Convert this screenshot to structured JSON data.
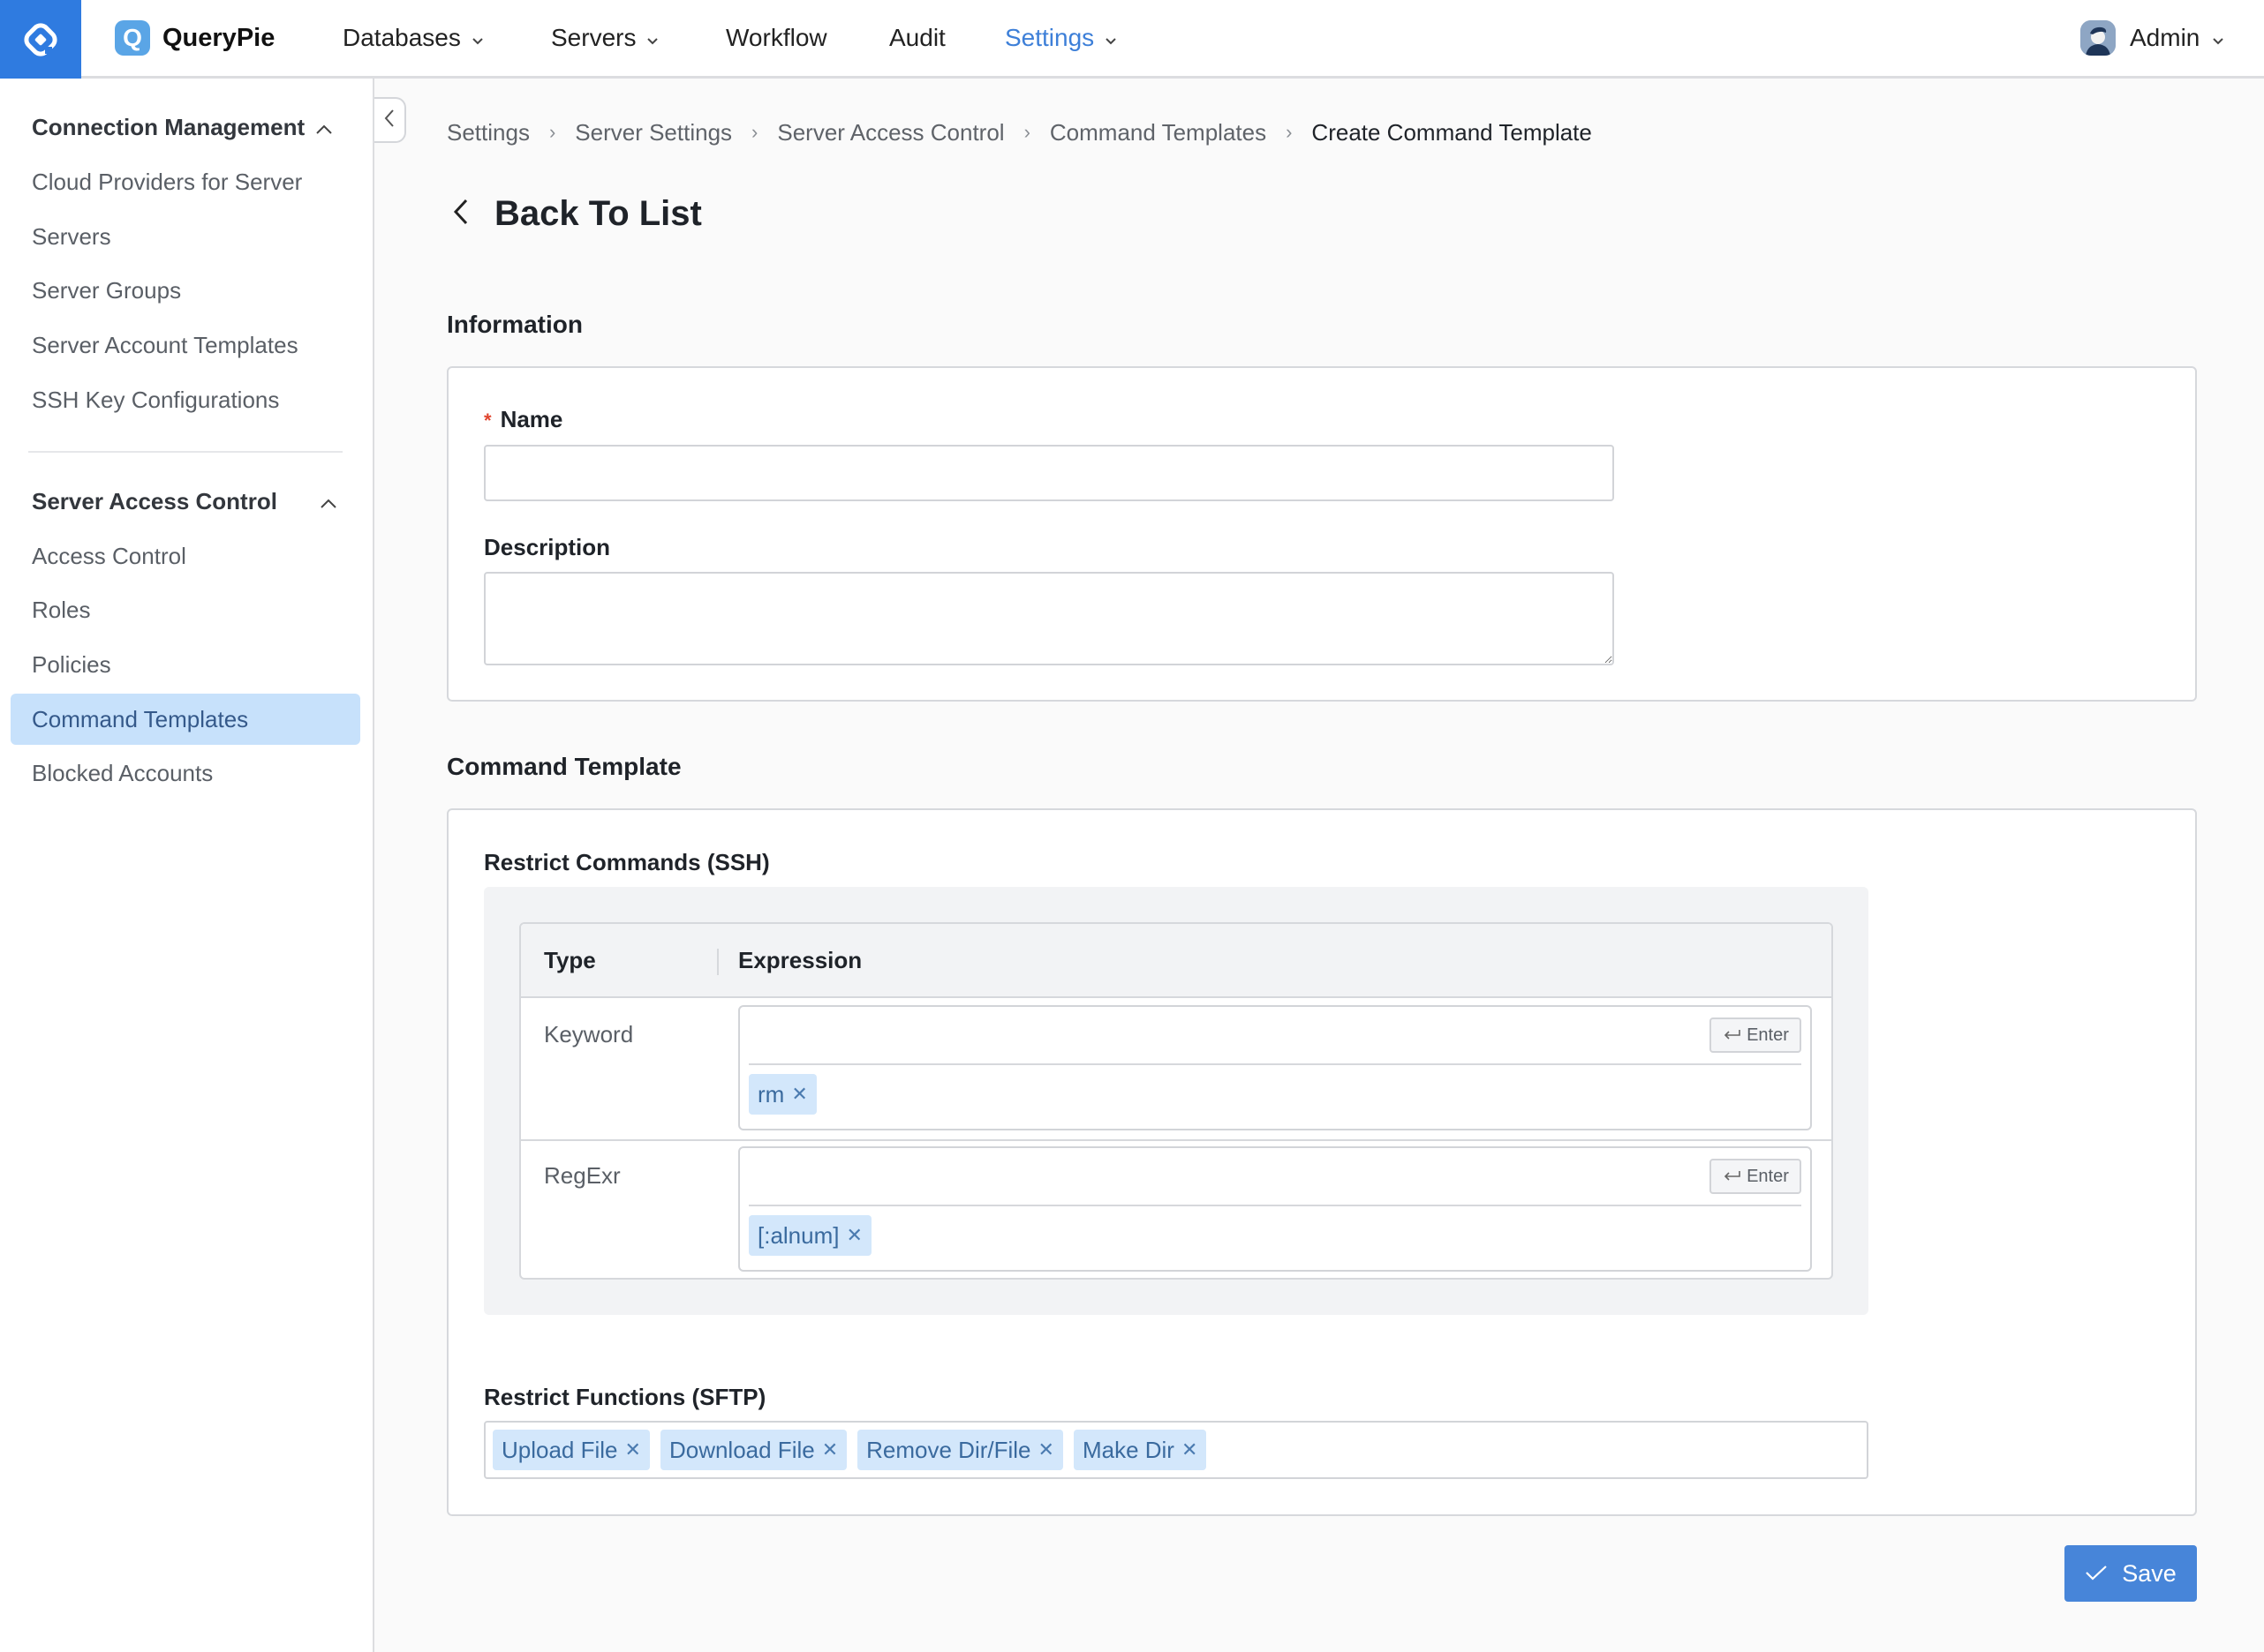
{
  "topbar": {
    "brand": "QueryPie",
    "brand_badge": "Q",
    "nav": [
      {
        "label": "Databases",
        "has_dropdown": true
      },
      {
        "label": "Servers",
        "has_dropdown": true
      },
      {
        "label": "Workflow",
        "has_dropdown": false
      },
      {
        "label": "Audit",
        "has_dropdown": false
      },
      {
        "label": "Settings",
        "has_dropdown": true,
        "active": true
      }
    ],
    "user": "Admin",
    "accent": "#2f7be0"
  },
  "sidebar": {
    "groups": [
      {
        "label": "Connection Management",
        "expanded": true,
        "items": [
          "Cloud Providers for Server",
          "Servers",
          "Server Groups",
          "Server Account Templates",
          "SSH Key Configurations"
        ]
      },
      {
        "label": "Server Access Control",
        "expanded": true,
        "items": [
          "Access Control",
          "Roles",
          "Policies",
          "Command Templates",
          "Blocked Accounts"
        ],
        "active_item": "Command Templates"
      }
    ]
  },
  "breadcrumb": [
    "Settings",
    "Server Settings",
    "Server Access Control",
    "Command Templates",
    "Create Command Template"
  ],
  "back_label": "Back To List",
  "information": {
    "title": "Information",
    "name_label": "Name",
    "name_required_mark": "*",
    "name_value": "",
    "description_label": "Description",
    "description_value": ""
  },
  "command_template": {
    "title": "Command Template",
    "ssh": {
      "title": "Restrict Commands (SSH)",
      "columns": [
        "Type",
        "Expression"
      ],
      "enter_label": "Enter",
      "rows": [
        {
          "type": "Keyword",
          "input_value": "",
          "tags": [
            "rm"
          ]
        },
        {
          "type": "RegExr",
          "input_value": "",
          "tags": [
            "[:alnum]"
          ]
        }
      ]
    },
    "sftp": {
      "title": "Restrict Functions (SFTP)",
      "tags": [
        "Upload File",
        "Download File",
        "Remove Dir/File",
        "Make Dir"
      ]
    }
  },
  "save_label": "Save"
}
